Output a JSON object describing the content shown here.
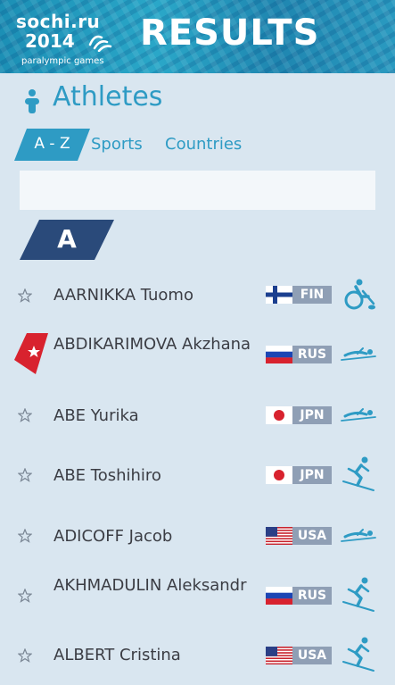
{
  "header": {
    "logo_line1": "sochi.ru",
    "logo_line2": "2014",
    "logo_line3": "paralympic games",
    "title": "RESULTS"
  },
  "page": {
    "title": "Athletes",
    "icon": "person-icon"
  },
  "tabs": [
    {
      "label": "A - Z",
      "active": true
    },
    {
      "label": "Sports",
      "active": false
    },
    {
      "label": "Countries",
      "active": false
    }
  ],
  "search": {
    "value": "",
    "placeholder": ""
  },
  "section_letter": "A",
  "colors": {
    "accent": "#2e9bc4",
    "letter_bg": "#2a4a7a",
    "background": "#d9e6f0",
    "country_badge": "#8f9fb5",
    "favorite": "#d8222e"
  },
  "athletes": [
    {
      "name": "AARNIKKA Tuomo",
      "country": "FIN",
      "flag": "finland-flag",
      "sport": "wheelchair-curling-icon",
      "favorite": false
    },
    {
      "name": "ABDIKARIMOVA Akzhana",
      "country": "RUS",
      "flag": "russia-flag",
      "sport": "biathlon-icon",
      "favorite": true
    },
    {
      "name": "ABE Yurika",
      "country": "JPN",
      "flag": "japan-flag",
      "sport": "biathlon-icon",
      "favorite": false
    },
    {
      "name": "ABE Toshihiro",
      "country": "JPN",
      "flag": "japan-flag",
      "sport": "alpine-skiing-icon",
      "favorite": false
    },
    {
      "name": "ADICOFF Jacob",
      "country": "USA",
      "flag": "usa-flag",
      "sport": "biathlon-icon",
      "favorite": false
    },
    {
      "name": "AKHMADULIN Aleksandr",
      "country": "RUS",
      "flag": "russia-flag",
      "sport": "alpine-skiing-icon",
      "favorite": false
    },
    {
      "name": "ALBERT Cristina",
      "country": "USA",
      "flag": "usa-flag",
      "sport": "alpine-skiing-icon",
      "favorite": false
    }
  ]
}
